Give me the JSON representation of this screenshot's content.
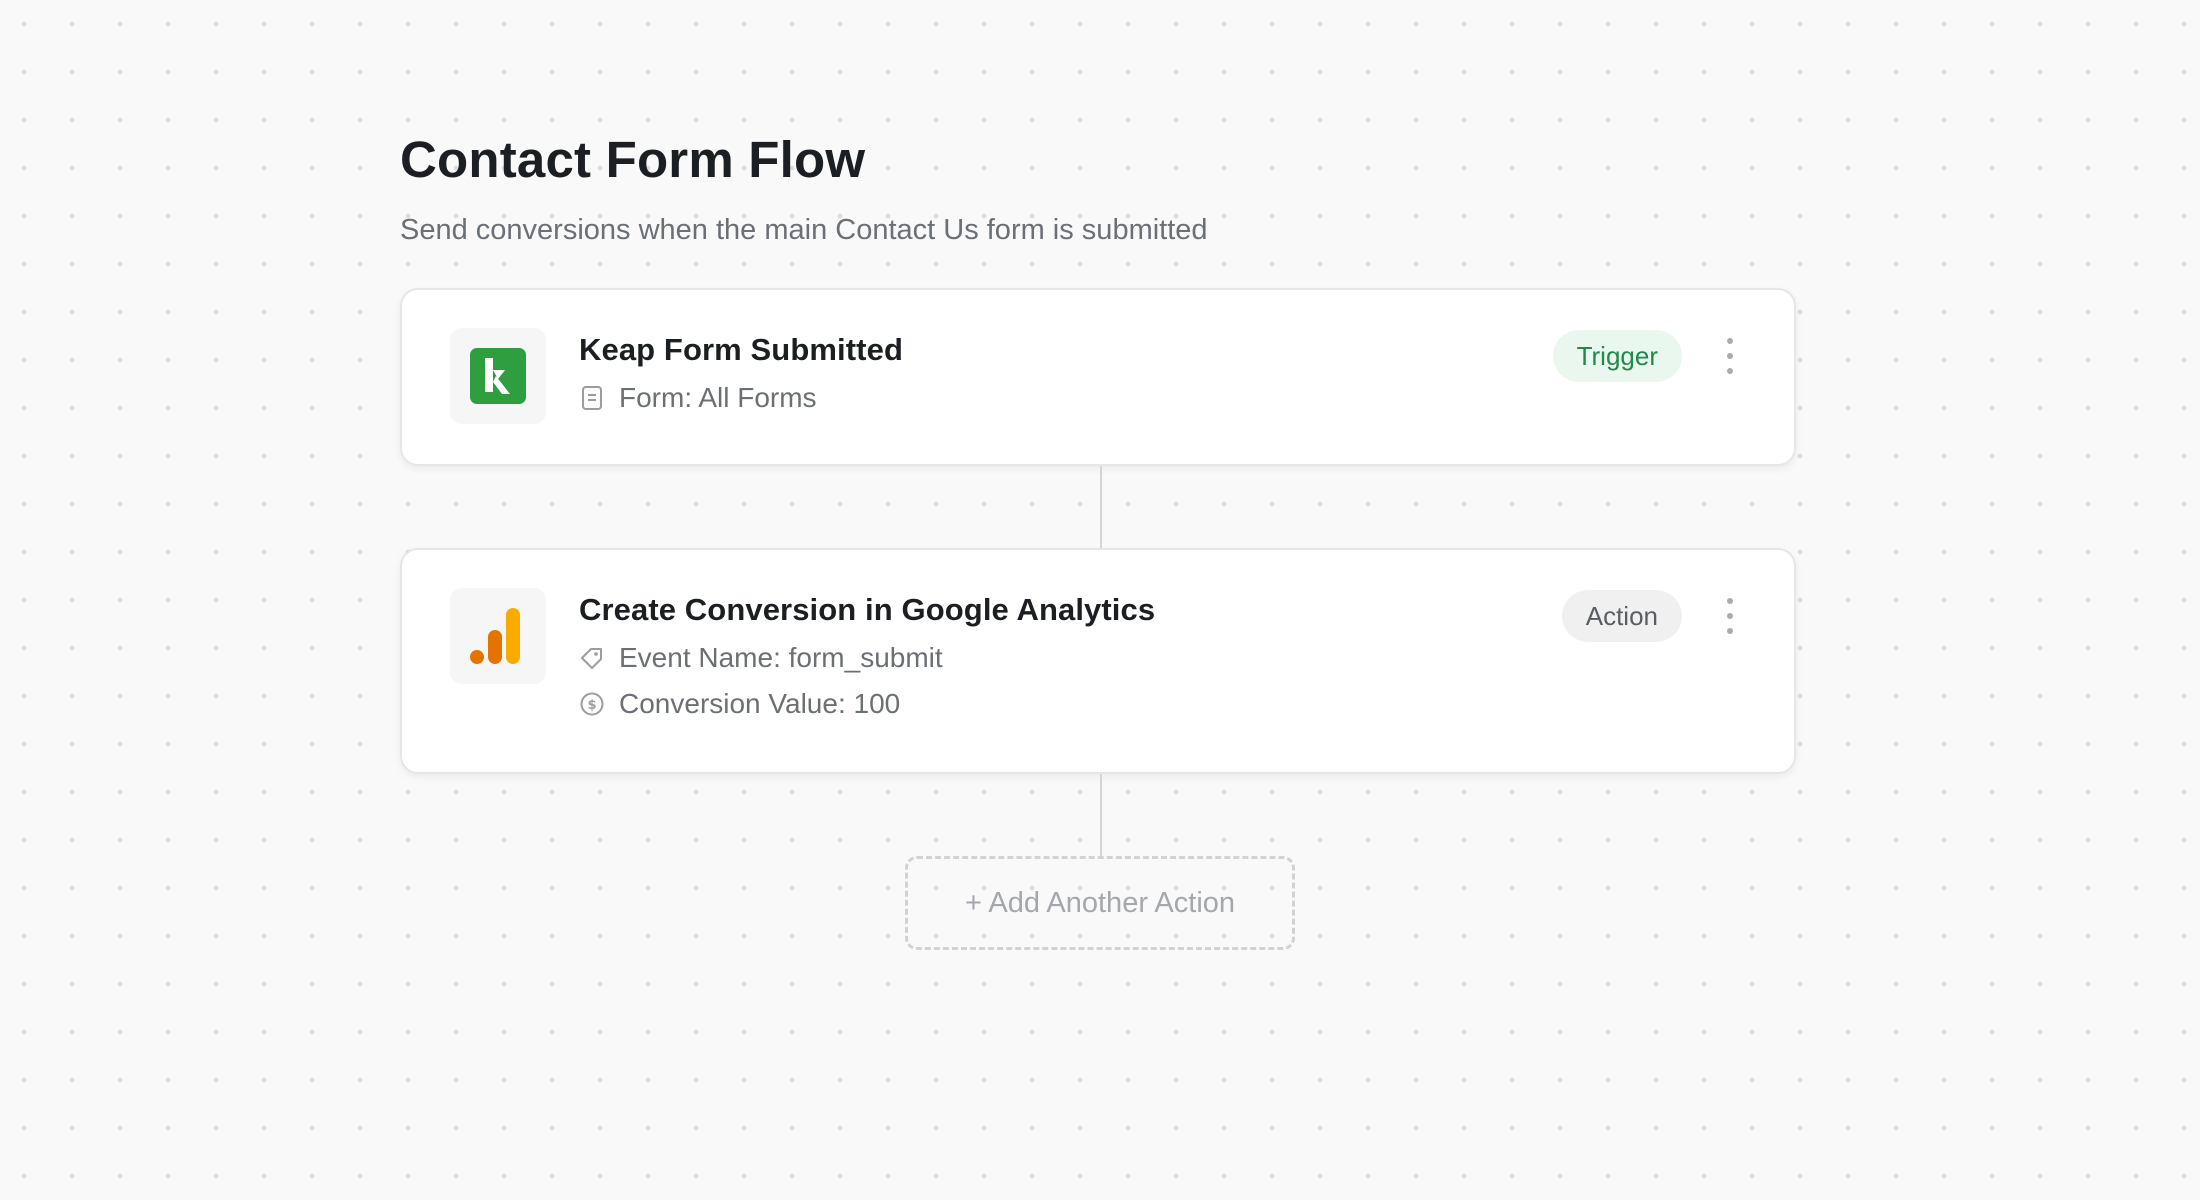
{
  "flow": {
    "title": "Contact Form Flow",
    "subtitle": "Send conversions when the main Contact Us form is submitted"
  },
  "trigger_step": {
    "app_icon": "keap-logo-icon",
    "title": "Keap Form Submitted",
    "badge": "Trigger",
    "meta": [
      {
        "icon": "form-icon",
        "text": "Form: All Forms"
      }
    ]
  },
  "action_step": {
    "app_icon": "google-analytics-logo-icon",
    "title": "Create Conversion in Google Analytics",
    "badge": "Action",
    "meta": [
      {
        "icon": "tag-icon",
        "text": "Event Name: form_submit"
      },
      {
        "icon": "dollar-icon",
        "text": "Conversion Value: 100"
      }
    ]
  },
  "add_action": {
    "label": "+ Add Another Action"
  },
  "colors": {
    "keap_green": "#2e9e3f",
    "ga_orange": "#f9ab00",
    "ga_dark_orange": "#e37400",
    "trigger_badge_bg": "#e9f7ee",
    "trigger_badge_text": "#1f8a4a",
    "action_badge_bg": "#f0f0f0"
  }
}
